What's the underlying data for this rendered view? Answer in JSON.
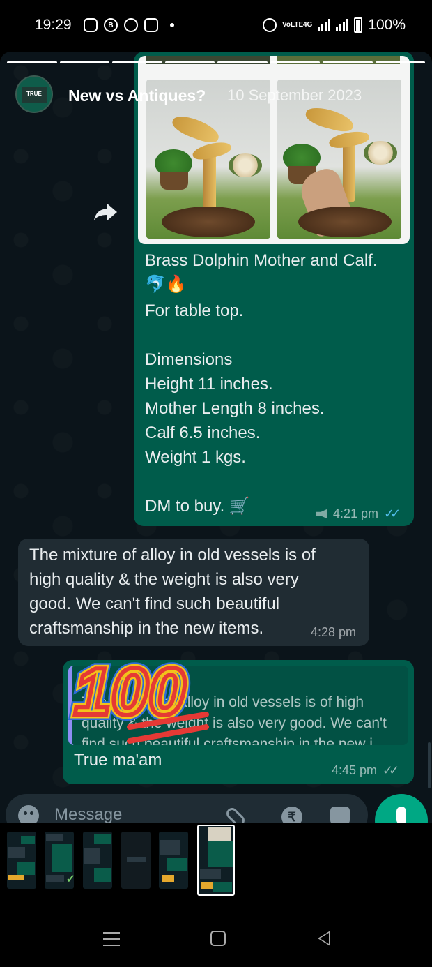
{
  "status_bar": {
    "time": "19:29",
    "network_label": "VoLTE",
    "network_type": "4G",
    "battery": "100%"
  },
  "story": {
    "name": "New vs Antiques?",
    "date": "10 September 2023",
    "avatar_label": "TRUE"
  },
  "outgoing_message": {
    "lines": [
      "Brass Dolphin Mother and Calf.",
      "🐬🔥",
      "For table top.",
      "",
      "Dimensions",
      "Height 11 inches.",
      "Mother Length 8 inches.",
      "Calf 6.5 inches.",
      "Weight 1 kgs.",
      "",
      "DM to buy. 🛒"
    ],
    "time": "4:21 pm",
    "ticks": "✓✓"
  },
  "incoming_message": {
    "text": "The mixture of alloy in old vessels is of high quality & the weight is also very good. We can't find such beautiful craftsmanship in the new items.",
    "time": "4:28 pm"
  },
  "reply_message": {
    "quote_name": "You",
    "quote_text": "The mixture of alloy in old vessels is of high quality & the weight is also very good. We can't find such beautiful craftsmanship in the new i...",
    "text": "True ma'am",
    "time": "4:45 pm",
    "ticks": "✓✓"
  },
  "input_bar": {
    "placeholder": "Message",
    "rupee_symbol": "₹"
  },
  "colors": {
    "outgoing_bubble": "#005c4b",
    "incoming_bubble": "#202c33",
    "chat_background": "#0b141a",
    "accent_green": "#00a884",
    "read_ticks": "#53bdeb"
  },
  "icons": [
    "share-icon",
    "emoji-icon",
    "attach-icon",
    "rupee-icon",
    "camera-icon",
    "mic-icon",
    "alarm-icon",
    "message-icon",
    "whatsapp-icon",
    "instagram-icon"
  ]
}
